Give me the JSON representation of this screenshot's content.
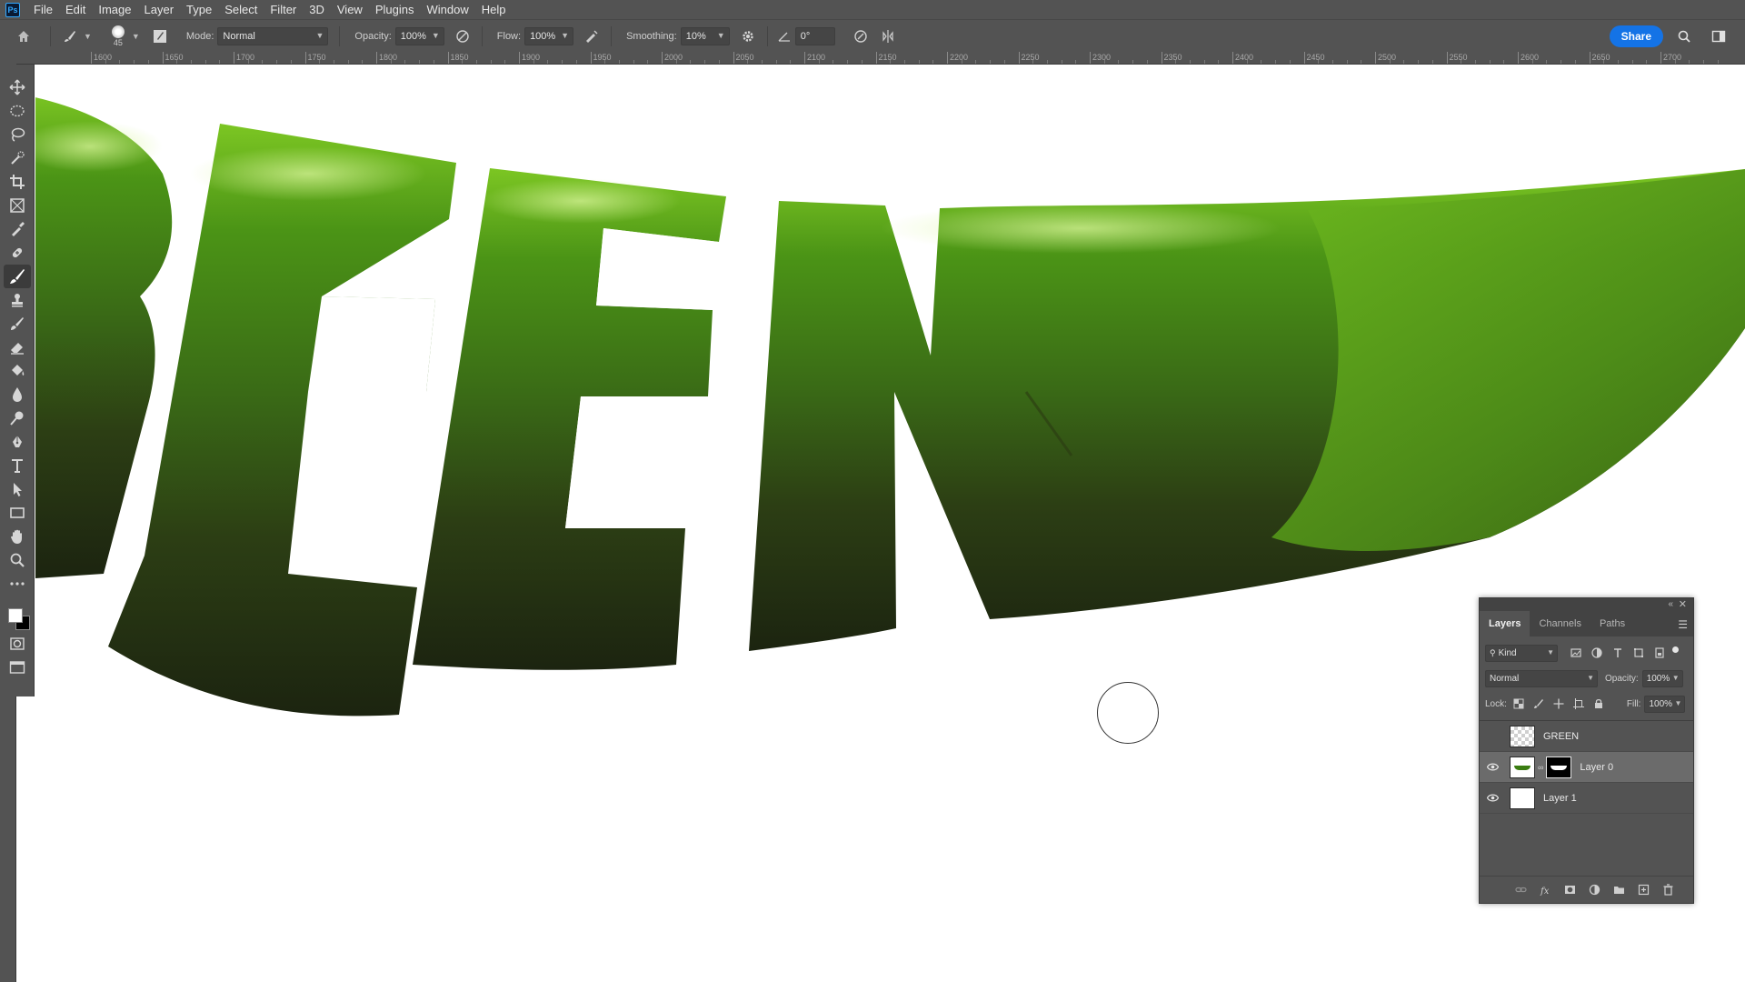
{
  "app": {
    "logo": "Ps"
  },
  "menu": [
    "File",
    "Edit",
    "Image",
    "Layer",
    "Type",
    "Select",
    "Filter",
    "3D",
    "View",
    "Plugins",
    "Window",
    "Help"
  ],
  "options": {
    "brush_size": "45",
    "mode_label": "Mode:",
    "mode_value": "Normal",
    "opacity_label": "Opacity:",
    "opacity_value": "100%",
    "flow_label": "Flow:",
    "flow_value": "100%",
    "smoothing_label": "Smoothing:",
    "smoothing_value": "10%",
    "angle_value": "0°",
    "share_label": "Share"
  },
  "ruler": {
    "labels": [
      "1600",
      "1650",
      "1700",
      "1750",
      "1800",
      "1850",
      "1900",
      "1950",
      "2000",
      "2050",
      "2100",
      "2150",
      "2200",
      "2250",
      "2300",
      "2350",
      "2400",
      "2450",
      "2500",
      "2550",
      "2600",
      "2650",
      "2700"
    ]
  },
  "tools": [
    "move-tool",
    "ellipse-marquee-tool",
    "lasso-tool",
    "quick-selection-tool",
    "crop-tool",
    "frame-tool",
    "eyedropper-tool",
    "healing-brush-tool",
    "brush-tool",
    "clone-stamp-tool",
    "history-brush-tool",
    "eraser-tool",
    "paint-bucket-tool",
    "blur-tool",
    "dodge-tool",
    "pen-tool",
    "type-tool",
    "path-selection-tool",
    "rectangle-tool",
    "hand-tool",
    "zoom-tool",
    "more-tools"
  ],
  "colors": {
    "foreground": "#ffffff",
    "background": "#000000",
    "accent": "#1473e6",
    "pepper_light": "#5da81e",
    "pepper_dark": "#1f2a10"
  },
  "layers_panel": {
    "tabs": [
      "Layers",
      "Channels",
      "Paths"
    ],
    "active_tab": "Layers",
    "filter_label": "Kind",
    "blend_mode": "Normal",
    "opacity_label": "Opacity:",
    "opacity_value": "100%",
    "lock_label": "Lock:",
    "fill_label": "Fill:",
    "fill_value": "100%",
    "layers": [
      {
        "name": "GREEN",
        "visible": false,
        "selected": false
      },
      {
        "name": "Layer 0",
        "visible": true,
        "selected": true
      },
      {
        "name": "Layer 1",
        "visible": true,
        "selected": false
      }
    ]
  }
}
